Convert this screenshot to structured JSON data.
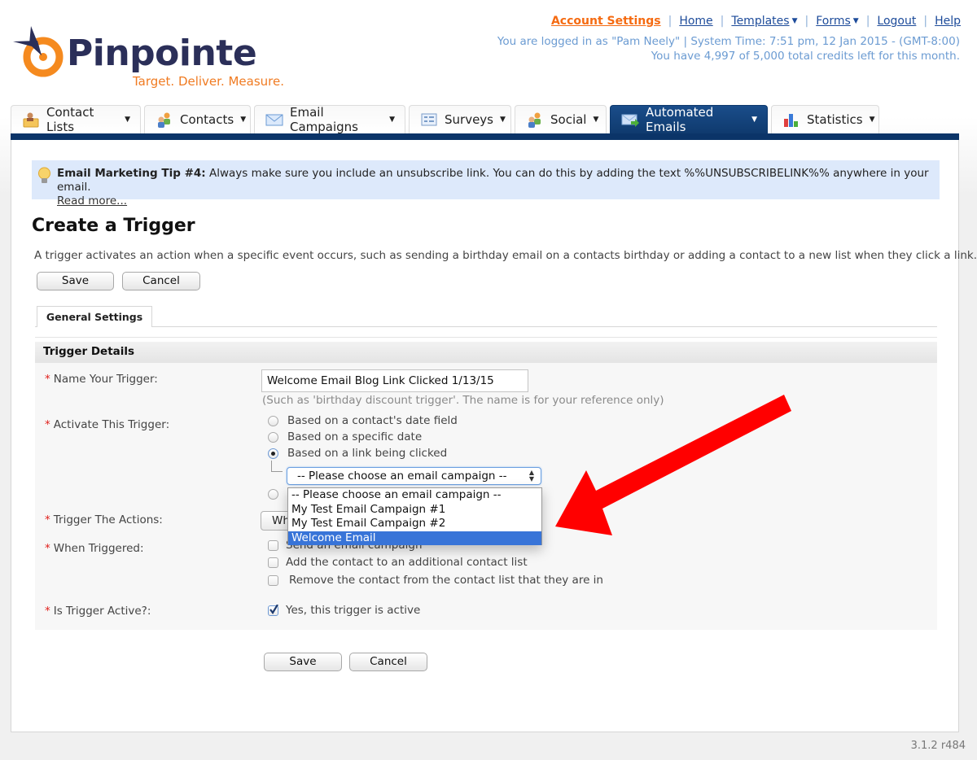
{
  "brand": {
    "name": "Pinpointe",
    "tagline": "Target. Deliver. Measure."
  },
  "header": {
    "links": [
      {
        "label": "Account Settings",
        "highlight": true
      },
      {
        "label": "Home"
      },
      {
        "label": "Templates",
        "dropdown": true
      },
      {
        "label": "Forms",
        "dropdown": true
      },
      {
        "label": "Logout"
      },
      {
        "label": "Help"
      }
    ],
    "login_info": "You are logged in as \"Pam Neely\" | System Time: 7:51 pm, 12 Jan 2015 - (GMT-8:00)",
    "credits_info": "You have 4,997 of 5,000 total credits left for this month."
  },
  "nav": {
    "tabs": [
      {
        "label": "Contact Lists",
        "icon": "contact-lists-icon"
      },
      {
        "label": "Contacts",
        "icon": "contacts-icon"
      },
      {
        "label": "Email Campaigns",
        "icon": "envelope-icon"
      },
      {
        "label": "Surveys",
        "icon": "survey-icon"
      },
      {
        "label": "Social",
        "icon": "social-icon"
      },
      {
        "label": "Automated Emails",
        "icon": "automated-email-icon",
        "active": true
      },
      {
        "label": "Statistics",
        "icon": "bar-chart-icon"
      }
    ],
    "caret": "▼"
  },
  "tip": {
    "title": "Email Marketing Tip #4:",
    "text": " Always make sure you include an unsubscribe link. You can do this by adding the text %%UNSUBSCRIBELINK%% anywhere in your email.",
    "read_more": "Read more..."
  },
  "page": {
    "title": "Create a Trigger",
    "description": "A trigger activates an action when a specific event occurs, such as sending a birthday email on a contacts birthday or adding a contact to a new list when they click a link.",
    "save_label": "Save",
    "cancel_label": "Cancel"
  },
  "form": {
    "subtab": "General Settings",
    "section_title": "Trigger Details",
    "required_mark": "*",
    "name_label": "Name Your Trigger:",
    "name_value": "Welcome Email Blog Link Clicked 1/13/15",
    "name_hint": "(Such as 'birthday discount trigger'. The name is for your reference only)",
    "activate_label": "Activate This Trigger:",
    "activate_options": [
      {
        "label": "Based on a contact's date field",
        "checked": false
      },
      {
        "label": "Based on a specific date",
        "checked": false
      },
      {
        "label": "Based on a link being clicked",
        "checked": true
      }
    ],
    "campaign_select": {
      "value": "-- Please choose an email campaign --",
      "options": [
        "-- Please choose an email campaign --",
        "My Test Email Campaign #1",
        "My Test Email Campaign #2",
        "Welcome Email"
      ],
      "highlighted": "Welcome Email"
    },
    "actions_label": "Trigger The Actions:",
    "actions_value": "When",
    "when_label": "When Triggered:",
    "when_options": [
      {
        "label": "Send an email campaign",
        "checked": false
      },
      {
        "label": "Add the contact to an additional contact list",
        "checked": false
      },
      {
        "label": "Remove the contact from the contact list that they are in",
        "checked": false
      }
    ],
    "active_label": "Is Trigger Active?:",
    "active_option": {
      "label": "Yes, this trigger is active",
      "checked": true
    }
  },
  "footer": {
    "version": "3.1.2 r484"
  },
  "colors": {
    "brand_navy": "#2b2f59",
    "brand_orange": "#f07b22",
    "nav_active": "#0f3a6e",
    "tip_bg": "#dde9fb",
    "annotation_arrow": "#ff0000",
    "selection": "#3874d8"
  }
}
